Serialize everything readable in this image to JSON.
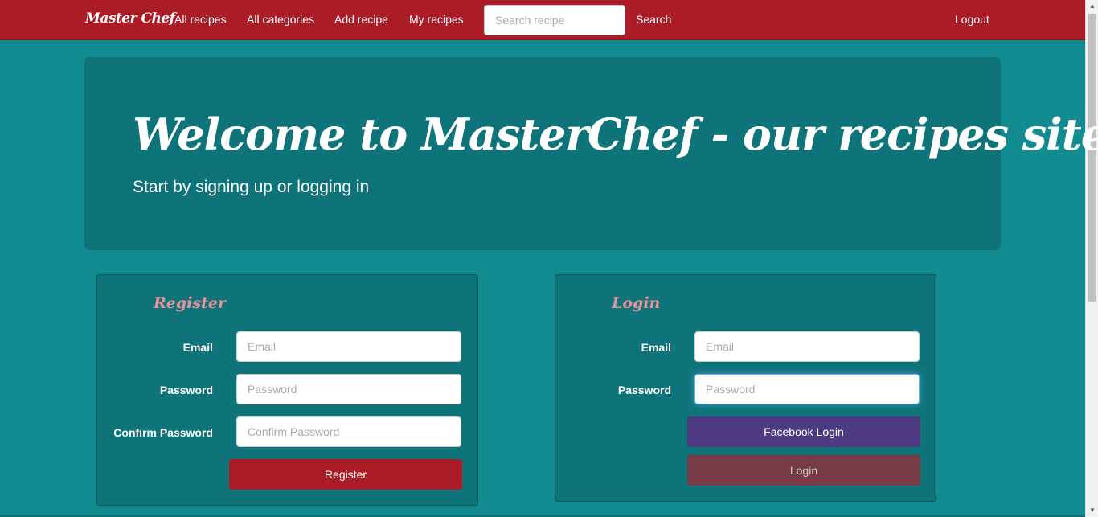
{
  "navbar": {
    "brand": "Master Chef",
    "links": [
      "All recipes",
      "All categories",
      "Add recipe",
      "My recipes"
    ],
    "search_placeholder": "Search recipe",
    "search_button": "Search",
    "logout": "Logout"
  },
  "jumbotron": {
    "title": "Welcome to MasterChef - our recipes site",
    "subtitle": "Start by signing up or logging in"
  },
  "register": {
    "title": "Register",
    "email_label": "Email",
    "email_placeholder": "Email",
    "password_label": "Password",
    "password_placeholder": "Password",
    "confirm_label": "Confirm Password",
    "confirm_placeholder": "Confirm Password",
    "button": "Register"
  },
  "login": {
    "title": "Login",
    "email_label": "Email",
    "email_placeholder": "Email",
    "password_label": "Password",
    "password_placeholder": "Password",
    "facebook_button": "Facebook Login",
    "button": "Login"
  },
  "colors": {
    "navbar": "#ab1c27",
    "background": "#128b91",
    "panel": "#0f747a",
    "panel_title": "#e8909a",
    "facebook": "#4d3a80",
    "login_button": "#763b45"
  }
}
